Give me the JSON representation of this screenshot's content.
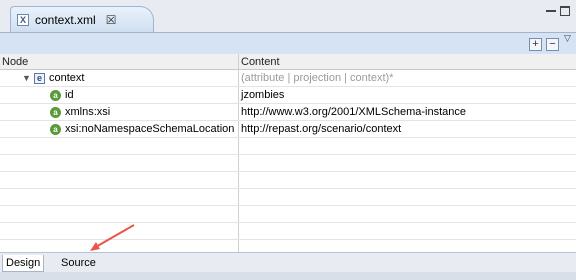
{
  "editor": {
    "tab_title": "context.xml",
    "tab_icon": "xml-file-icon",
    "close_glyph": "☒"
  },
  "toolbar": {
    "expand_glyph": "+",
    "collapse_glyph": "−",
    "menu_glyph": "▽"
  },
  "table": {
    "headers": [
      "Node",
      "Content"
    ],
    "rows": [
      {
        "node": "context",
        "content": "(attribute | projection | context)*",
        "icon": "e",
        "twisty": "▼",
        "depth": 0,
        "hint": true
      },
      {
        "node": "id",
        "content": "jzombies",
        "icon": "a",
        "depth": 1
      },
      {
        "node": "xmlns:xsi",
        "content": "http://www.w3.org/2001/XMLSchema-instance",
        "icon": "a",
        "depth": 1
      },
      {
        "node": "xsi:noNamespaceSchemaLocation",
        "content": "http://repast.org/scenario/context",
        "icon": "a",
        "depth": 1
      }
    ]
  },
  "bottom_tabs": {
    "design": "Design",
    "source": "Source"
  },
  "colors": {
    "arrow": "#e8574a",
    "attribute_icon": "#5a9a38",
    "element_icon": "#2c4f8c"
  }
}
